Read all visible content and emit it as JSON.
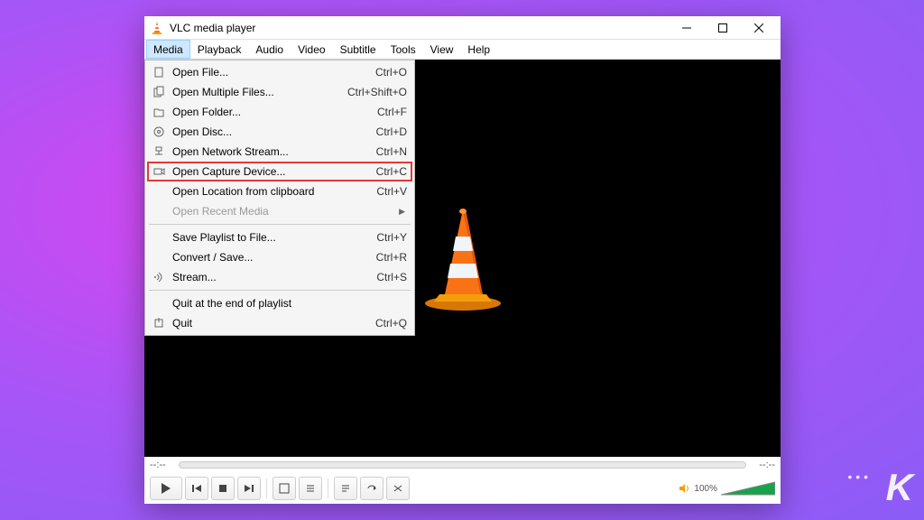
{
  "titlebar": {
    "title": "VLC media player"
  },
  "menubar": {
    "items": [
      "Media",
      "Playback",
      "Audio",
      "Video",
      "Subtitle",
      "Tools",
      "View",
      "Help"
    ]
  },
  "dropdown": {
    "groups": [
      [
        {
          "icon": "file-icon",
          "label": "Open File...",
          "shortcut": "Ctrl+O"
        },
        {
          "icon": "files-icon",
          "label": "Open Multiple Files...",
          "shortcut": "Ctrl+Shift+O"
        },
        {
          "icon": "folder-icon",
          "label": "Open Folder...",
          "shortcut": "Ctrl+F"
        },
        {
          "icon": "disc-icon",
          "label": "Open Disc...",
          "shortcut": "Ctrl+D"
        },
        {
          "icon": "network-icon",
          "label": "Open Network Stream...",
          "shortcut": "Ctrl+N"
        },
        {
          "icon": "capture-icon",
          "label": "Open Capture Device...",
          "shortcut": "Ctrl+C",
          "highlight": true
        },
        {
          "icon": "",
          "label": "Open Location from clipboard",
          "shortcut": "Ctrl+V"
        },
        {
          "icon": "",
          "label": "Open Recent Media",
          "shortcut": "",
          "disabled": true,
          "submenu": true
        }
      ],
      [
        {
          "icon": "",
          "label": "Save Playlist to File...",
          "shortcut": "Ctrl+Y"
        },
        {
          "icon": "",
          "label": "Convert / Save...",
          "shortcut": "Ctrl+R"
        },
        {
          "icon": "stream-icon",
          "label": "Stream...",
          "shortcut": "Ctrl+S"
        }
      ],
      [
        {
          "icon": "",
          "label": "Quit at the end of playlist",
          "shortcut": ""
        },
        {
          "icon": "quit-icon",
          "label": "Quit",
          "shortcut": "Ctrl+Q"
        }
      ]
    ]
  },
  "seek": {
    "left": "--:--",
    "right": "--:--"
  },
  "volume": {
    "label": "100%"
  },
  "watermark": {
    "text": "K"
  }
}
